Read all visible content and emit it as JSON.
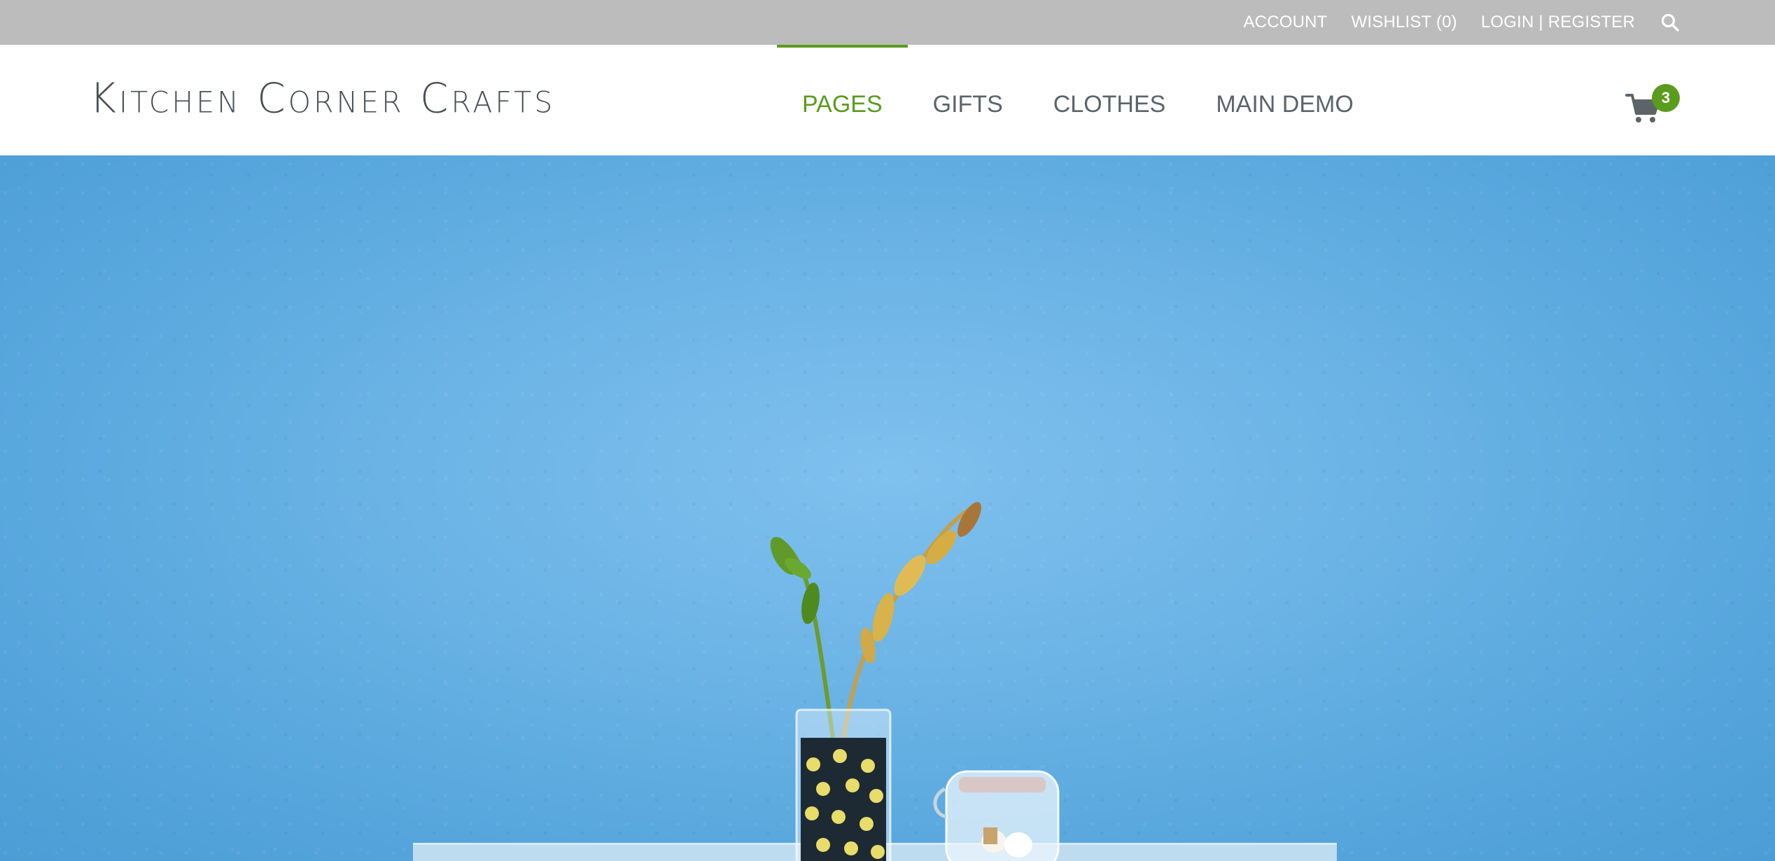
{
  "topbar": {
    "account_label": "ACCOUNT",
    "wishlist_label": "WISHLIST (0)",
    "login_label": "LOGIN | REGISTER",
    "search_icon": "search-icon"
  },
  "header": {
    "logo": "Kitchen Corner Crafts",
    "nav": [
      {
        "label": "PAGES",
        "active": true
      },
      {
        "label": "GIFTS",
        "active": false
      },
      {
        "label": "CLOTHES",
        "active": false
      },
      {
        "label": "MAIN DEMO",
        "active": false
      }
    ],
    "cart_count": "3",
    "cart_icon": "cart-icon"
  },
  "colors": {
    "accent": "#5b9b1d",
    "topbar_bg": "#bcbcbc",
    "nav_text": "#5c6469",
    "hero_blue": "#6db5e6"
  }
}
